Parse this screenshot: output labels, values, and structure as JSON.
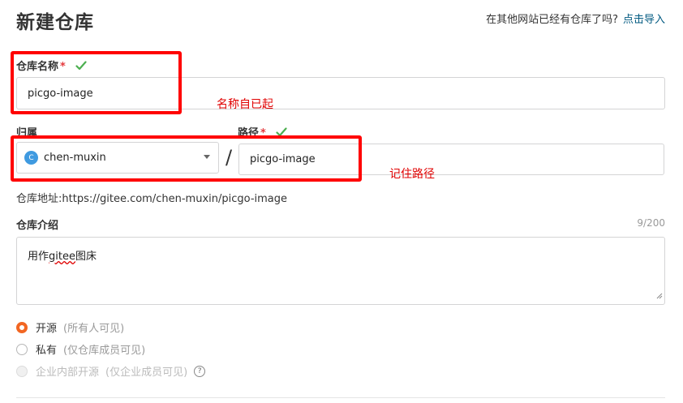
{
  "page": {
    "title": "新建仓库",
    "import_prompt": "在其他网站已经有仓库了吗?",
    "import_link": "点击导入"
  },
  "repo_name": {
    "label": "仓库名称",
    "required_mark": "*",
    "value": "picgo-image",
    "annotation": "名称自已起"
  },
  "owner": {
    "label": "归属",
    "avatar_letter": "C",
    "value": "chen-muxin"
  },
  "path": {
    "separator": "/",
    "label": "路径",
    "required_mark": "*",
    "value": "picgo-image",
    "annotation": "记住路径"
  },
  "repo_address": {
    "label": "仓库地址:",
    "value": "https://gitee.com/chen-muxin/picgo-image"
  },
  "description": {
    "label": "仓库介绍",
    "counter": "9/200",
    "value": "用作gitee图床",
    "value_prefix": "用作",
    "value_underlined": "gitee",
    "value_suffix": "图床"
  },
  "visibility": {
    "selected": "open",
    "options": [
      {
        "id": "open",
        "label": "开源",
        "note": "(所有人可见)"
      },
      {
        "id": "private",
        "label": "私有",
        "note": "(仅仓库成员可见)"
      },
      {
        "id": "internal",
        "label": "企业内部开源",
        "note": "(仅企业成员可见)",
        "disabled": true
      }
    ],
    "help_symbol": "?"
  },
  "colors": {
    "annotation_red": "#ff0000",
    "link_blue": "#005980",
    "check_green": "#4caf50",
    "radio_orange": "#f26622"
  }
}
